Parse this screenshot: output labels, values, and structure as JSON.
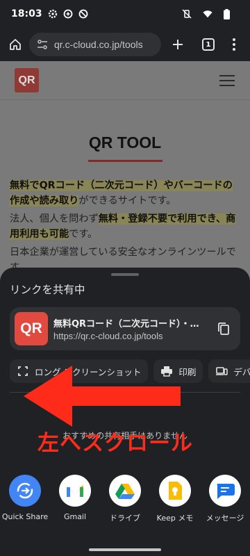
{
  "status_bar": {
    "time": "18:03"
  },
  "browser": {
    "url": "qr.c-cloud.co.jp/tools",
    "tab_count": "1"
  },
  "page": {
    "logo": "QR",
    "title": "QR TOOL",
    "para1_hl1": "無料でQRコード（二次元コード）やバーコードの作成や読み取り",
    "para1_rest": "ができるサイトです。",
    "para2_pre": "法人、個人を問わず",
    "para2_hl": "無料・登録不要で利用でき、商用利用も可能",
    "para2_post": "です。",
    "para3": "日本企業が運営している安全なオンラインツールです。"
  },
  "share_sheet": {
    "title": "リンクを共有中",
    "link_title": "無料QRコード（二次元コード）・バーコード作成・読み取り",
    "link_url": "https://qr.c-cloud.co.jp/tools",
    "thumb_text": "QR",
    "actions": [
      {
        "label": "ロング スクリーンショット",
        "icon": "long-screenshot-icon"
      },
      {
        "label": "印刷",
        "icon": "print-icon"
      },
      {
        "label": "デバイスに送信",
        "icon": "send-to-device-icon"
      }
    ],
    "no_recommendation": "おすすめの共有相手はありません",
    "apps": [
      {
        "label": "Quick Share",
        "icon": "quick-share-icon"
      },
      {
        "label": "Gmail",
        "icon": "gmail-icon"
      },
      {
        "label": "ドライブ",
        "icon": "drive-icon"
      },
      {
        "label": "Keep メモ",
        "icon": "keep-icon"
      },
      {
        "label": "メッセージ",
        "icon": "messages-icon"
      }
    ]
  },
  "annotation": {
    "text": "左へスクロール",
    "color": "#ff2b1a"
  },
  "colors": {
    "sheet_bg": "#202124",
    "accent_red": "#e2493f"
  }
}
